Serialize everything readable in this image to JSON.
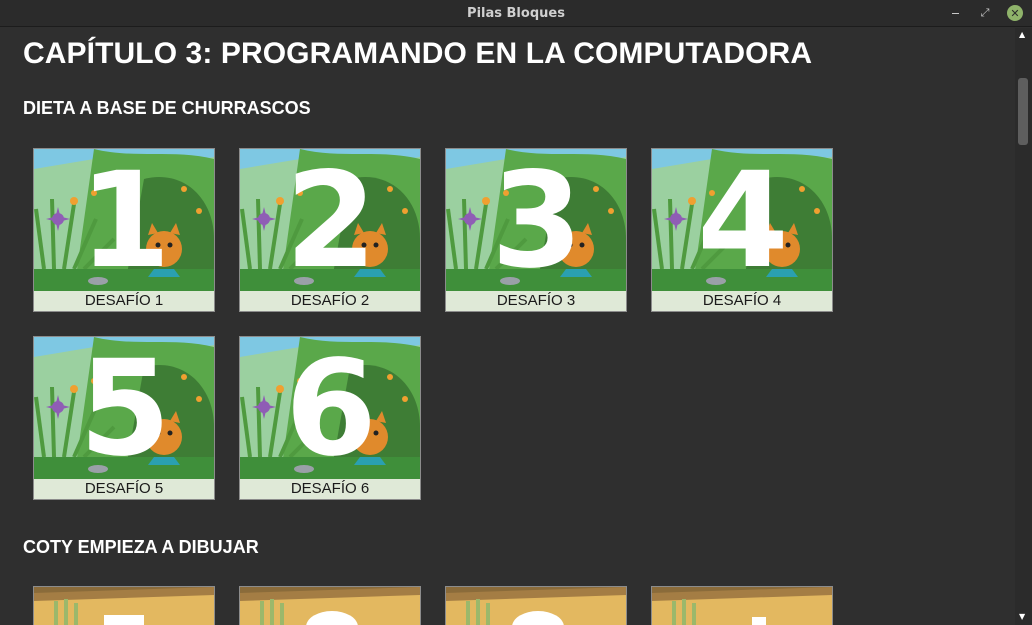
{
  "window": {
    "title": "Pilas Bloques",
    "minimize_glyph": "",
    "maximize_glyph": "⤢",
    "close_glyph": "✕"
  },
  "chapter": {
    "title": "CAPÍTULO 3: PROGRAMANDO EN LA COMPUTADORA"
  },
  "sections": [
    {
      "title": "DIETA A BASE DE CHURRASCOS",
      "challenges": [
        {
          "number": "1",
          "label": "DESAFÍO 1"
        },
        {
          "number": "2",
          "label": "DESAFÍO 2"
        },
        {
          "number": "3",
          "label": "DESAFÍO 3"
        },
        {
          "number": "4",
          "label": "DESAFÍO 4"
        },
        {
          "number": "5",
          "label": "DESAFÍO 5"
        },
        {
          "number": "6",
          "label": "DESAFÍO 6"
        }
      ]
    },
    {
      "title": "COTY EMPIEZA A DIBUJAR",
      "visible_cards": 4
    }
  ],
  "scrollbar": {
    "up_icon": "▲",
    "down_icon": "▼"
  },
  "colors": {
    "background": "#2f2f2f",
    "titlebar": "#2b2b2b",
    "card_label_bg": "#dfe9d7",
    "close_button": "#8fb36a"
  }
}
